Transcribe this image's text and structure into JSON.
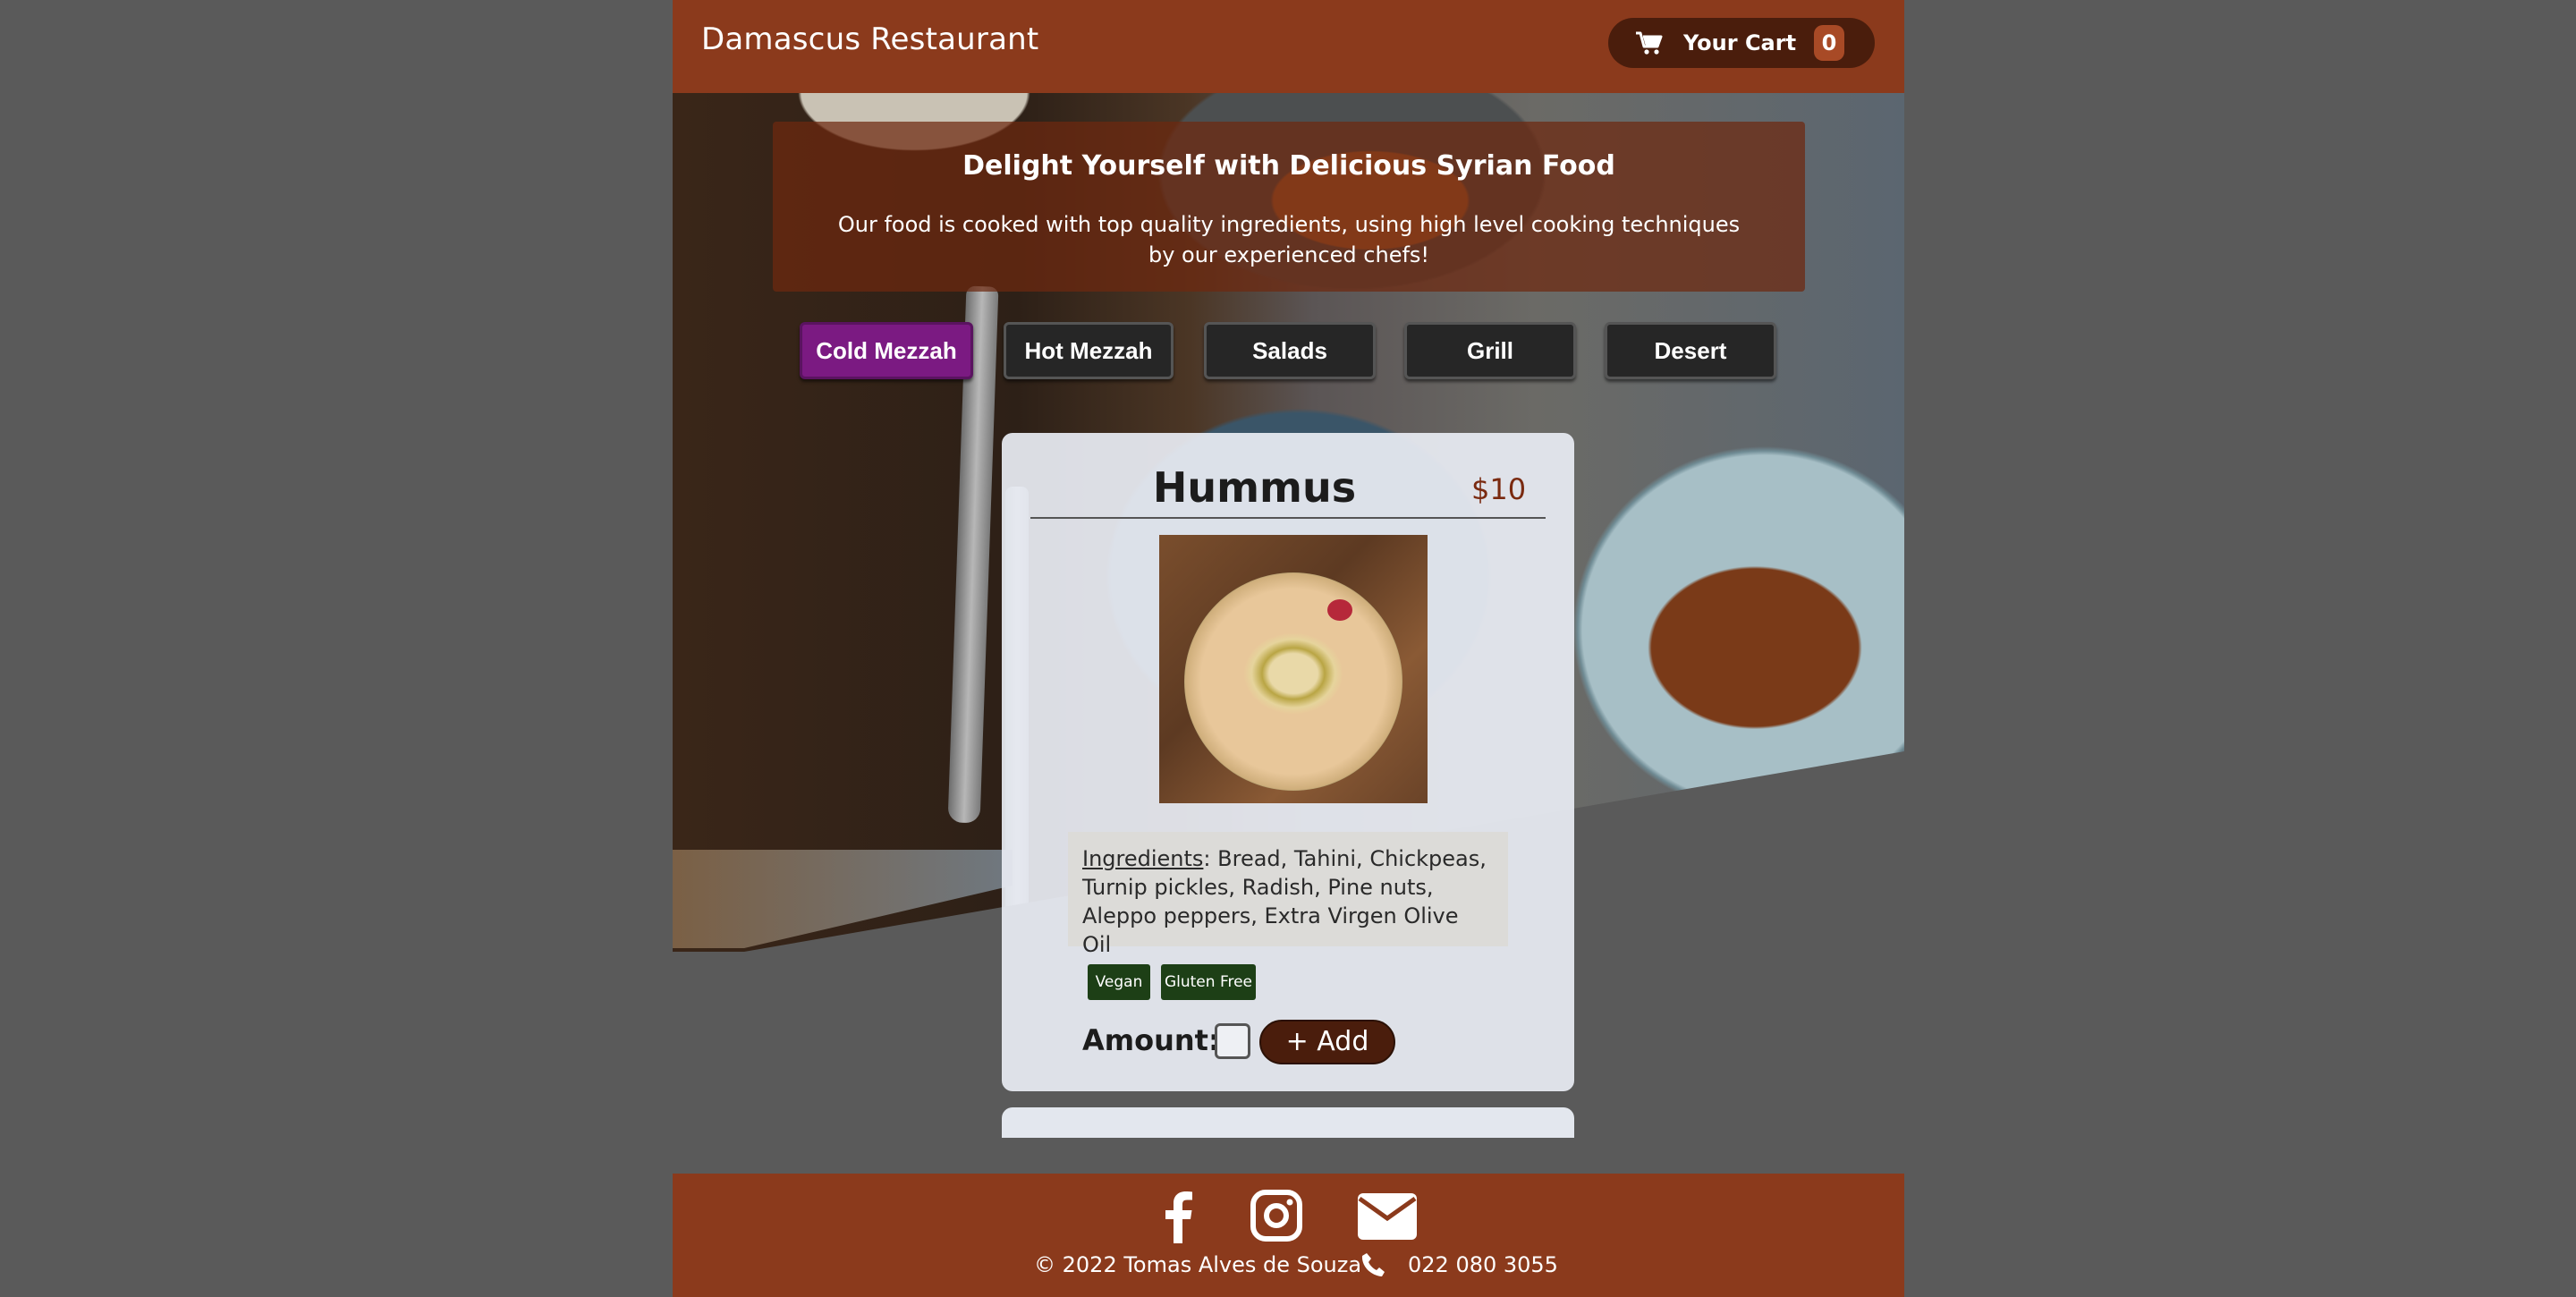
{
  "header": {
    "brand": "Damascus Restaurant",
    "cart_label": "Your Cart",
    "cart_count": "0"
  },
  "intro": {
    "title": "Delight Yourself with Delicious Syrian Food",
    "text": "Our food is cooked with top quality ingredients, using high level cooking techniques by our experienced chefs!"
  },
  "tabs": [
    {
      "label": "Cold Mezzah",
      "active": true
    },
    {
      "label": "Hot Mezzah",
      "active": false
    },
    {
      "label": "Salads",
      "active": false
    },
    {
      "label": "Grill",
      "active": false
    },
    {
      "label": "Desert",
      "active": false
    }
  ],
  "dish": {
    "name": "Hummus",
    "price": "$10",
    "ingredients_label": "Ingredients",
    "ingredients": ": Bread, Tahini, Chickpeas, Turnip pickles, Radish, Pine nuts, Aleppo peppers, Extra Virgen Olive Oil",
    "tags": [
      "Vegan",
      "Gluten Free"
    ],
    "amount_label": "Amount:",
    "amount_value": "",
    "add_label": "+ Add"
  },
  "footer": {
    "icons": [
      "facebook-icon",
      "instagram-icon",
      "envelope-icon"
    ],
    "copyright": "© 2022 Tomas Alves de Souza",
    "phone": "022 080 3055"
  },
  "colors": {
    "brand": "#8b3a1c",
    "brand_dark": "#4a1d0c",
    "active_tab": "#7b1a82",
    "tag_green": "#1d3f16"
  }
}
